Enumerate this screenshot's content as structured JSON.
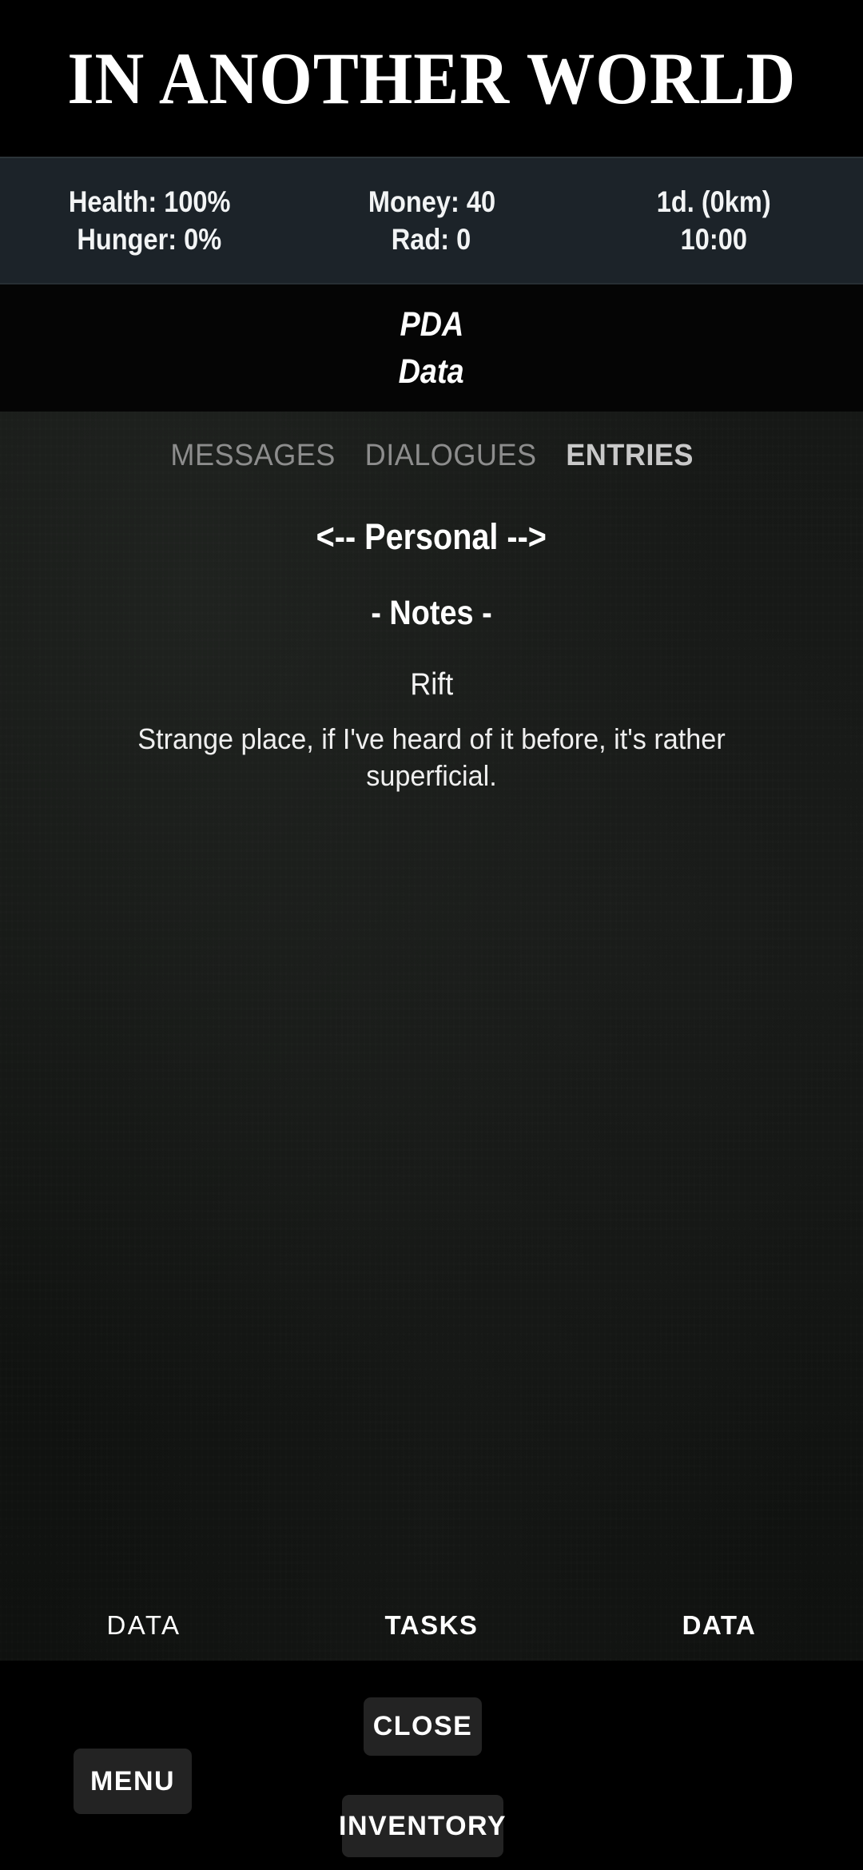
{
  "game": {
    "title": "IN ANOTHER WORLD"
  },
  "status": {
    "health": "Health: 100%",
    "hunger": "Hunger: 0%",
    "money": "Money: 40",
    "rad": "Rad: 0",
    "day_distance": "1d. (0km)",
    "time": "10:00"
  },
  "pda": {
    "title": "PDA",
    "subtitle": "Data"
  },
  "tabs": [
    {
      "label": "MESSAGES",
      "active": false
    },
    {
      "label": "DIALOGUES",
      "active": false
    },
    {
      "label": "ENTRIES",
      "active": true
    }
  ],
  "entries": {
    "category_nav": "<-- Personal -->",
    "section_header": "- Notes -",
    "items": [
      {
        "title": "Rift",
        "body": "Strange place, if I've heard of it before, it's rather superficial."
      }
    ]
  },
  "panel_nav": [
    {
      "label": "DATA",
      "strong": false
    },
    {
      "label": "TASKS",
      "strong": true
    },
    {
      "label": "DATA",
      "strong": true
    }
  ],
  "actions": {
    "menu": "MENU",
    "close": "CLOSE",
    "inventory": "INVENTORY"
  },
  "colors": {
    "background": "#000000",
    "status_bar": "#1c2329",
    "panel": "#131513",
    "button": "#232323",
    "text_primary": "#ffffff",
    "tab_inactive": "#8d8d8d",
    "tab_active": "#c9c9c9"
  }
}
